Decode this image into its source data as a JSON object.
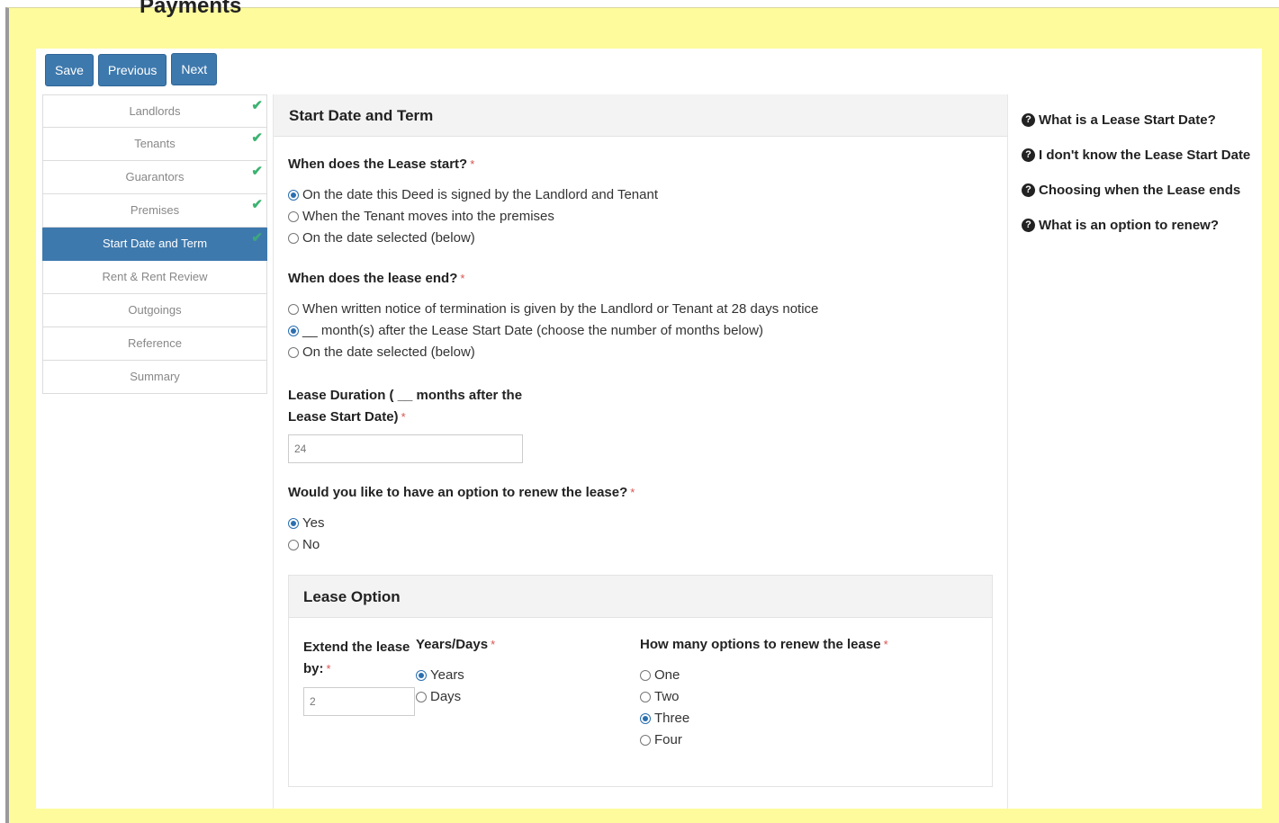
{
  "page": {
    "clipped_title": "Payments"
  },
  "toolbar": {
    "save": "Save",
    "previous": "Previous",
    "next": "Next"
  },
  "steps": [
    {
      "label": "Landlords",
      "done": true
    },
    {
      "label": "Tenants",
      "done": true
    },
    {
      "label": "Guarantors",
      "done": true
    },
    {
      "label": "Premises",
      "done": true
    },
    {
      "label": "Start Date and Term",
      "done": true,
      "active": true
    },
    {
      "label": "Rent & Rent Review",
      "done": false
    },
    {
      "label": "Outgoings",
      "done": false
    },
    {
      "label": "Reference",
      "done": false
    },
    {
      "label": "Summary",
      "done": false
    }
  ],
  "check_glyph": "✔",
  "section": {
    "title": "Start Date and Term",
    "required_mark": "*",
    "start": {
      "question": "When does the Lease start?",
      "options": [
        "On the date this Deed is signed by the Landlord and Tenant",
        "When the Tenant moves into the premises",
        "On the date selected (below)"
      ],
      "selected": 0
    },
    "end": {
      "question": "When does the lease end?",
      "options": [
        "When written notice of termination is given by the Landlord or Tenant at 28 days notice",
        "__ month(s) after the Lease Start Date (choose the number of months below)",
        "On the date selected (below)"
      ],
      "selected": 1
    },
    "duration": {
      "label_line1": "Lease Duration ( __ months after the",
      "label_line2": "Lease Start Date)",
      "value": "24"
    },
    "renew": {
      "question": "Would you like to have an option to renew the lease?",
      "options": [
        "Yes",
        "No"
      ],
      "selected": 0
    },
    "lease_option": {
      "title": "Lease Option",
      "extend_label_line1": "Extend the lease",
      "extend_label_line2": "by:",
      "extend_value": "2",
      "unit_label": "Years/Days",
      "units": [
        "Years",
        "Days"
      ],
      "unit_selected": 0,
      "count_label": "How many options to renew the lease",
      "counts": [
        "One",
        "Two",
        "Three",
        "Four"
      ],
      "count_selected": 2
    }
  },
  "help": {
    "icon": "?",
    "links": [
      "What is a Lease Start Date?",
      "I don't know the Lease Start Date",
      "Choosing when the Lease ends",
      "What is an option to renew?"
    ]
  },
  "colors": {
    "frame_bg": "#fdfb9c",
    "primary": "#3e79ad",
    "check": "#3cb371",
    "required": "#d9534f"
  }
}
